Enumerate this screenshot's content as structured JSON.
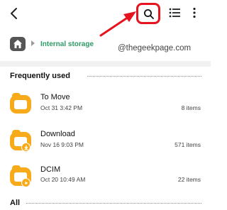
{
  "watermark": "@thegeekpage.com",
  "breadcrumb": {
    "label": "Internal storage"
  },
  "sections": {
    "frequently_used": "Frequently used",
    "all": "All"
  },
  "folders": [
    {
      "name": "To Move",
      "date": "Oct 31 3:42 PM",
      "count": "8 items"
    },
    {
      "name": "Download",
      "date": "Nov 16 9:03 PM",
      "count": "571 items"
    },
    {
      "name": "DCIM",
      "date": "Oct 20 10:49 AM",
      "count": "22 items"
    }
  ],
  "colors": {
    "accent_green": "#2e9b66",
    "folder_yellow": "#f7ab1b",
    "highlight_red": "#e5141f"
  },
  "icons": {
    "back": "back-arrow-icon",
    "search": "search-icon",
    "list_view": "list-view-icon",
    "more": "more-options-icon",
    "home": "home-icon",
    "annotation": "red-arrow-annotation"
  }
}
